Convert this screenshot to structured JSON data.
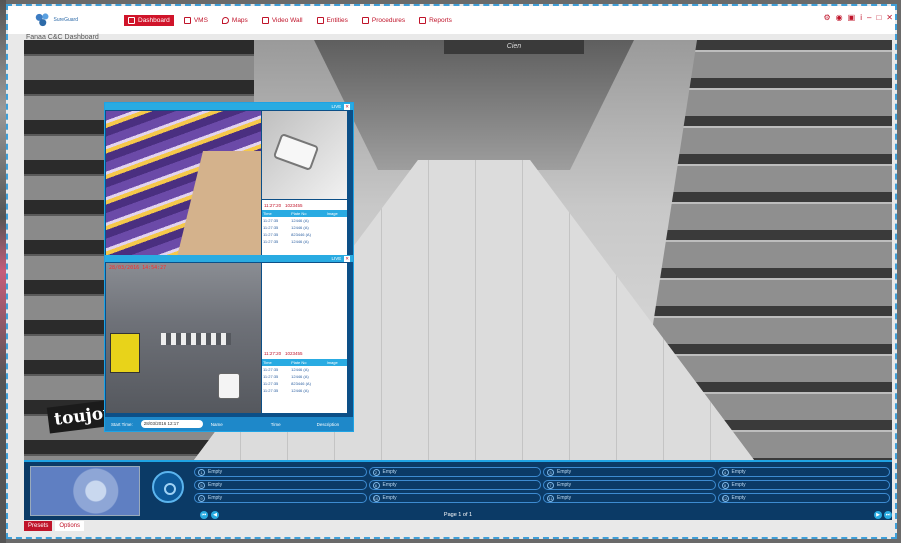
{
  "app": {
    "logo_text": "SureGuard",
    "subtitle": "Fanaa C&C Dashboard"
  },
  "nav": [
    {
      "label": "Dashboard",
      "icon": "dashboard-icon",
      "active": true
    },
    {
      "label": "VMS",
      "icon": "camera-icon",
      "active": false
    },
    {
      "label": "Maps",
      "icon": "map-pin-icon",
      "active": false
    },
    {
      "label": "Video Wall",
      "icon": "grid-icon",
      "active": false
    },
    {
      "label": "Entities",
      "icon": "entities-icon",
      "active": false
    },
    {
      "label": "Procedures",
      "icon": "procedures-icon",
      "active": false
    },
    {
      "label": "Reports",
      "icon": "chart-icon",
      "active": false
    }
  ],
  "window_controls": [
    "⚙",
    "◉",
    "▣",
    "i",
    "–",
    "□",
    "✕"
  ],
  "scene": {
    "ceiling_sign": "Cien",
    "brand_sign": "toujours"
  },
  "panel": {
    "live_label": "LIVE",
    "close_label": "✕",
    "feed2_timestamp": "28/03/2016 14:54:27",
    "event_time_a": "11:27:20",
    "event_time_b": "11:27:20",
    "event_id": "1023455",
    "table_headers": [
      "Time",
      "Plate No",
      "Image"
    ],
    "rows_a": [
      [
        "11:27:35",
        "12446 (A)",
        ""
      ],
      [
        "11:27:35",
        "12446 (A)",
        ""
      ],
      [
        "11:27:35",
        "823446 (A)",
        ""
      ],
      [
        "11:27:35",
        "12446 (A)",
        ""
      ]
    ],
    "rows_b": [
      [
        "11:27:35",
        "12446 (A)",
        ""
      ],
      [
        "11:27:35",
        "12446 (A)",
        ""
      ],
      [
        "11:27:35",
        "823446 (A)",
        ""
      ],
      [
        "11:27:35",
        "12446 (A)",
        ""
      ]
    ],
    "footer": {
      "start_time_label": "Start Time:",
      "start_time_value": "28/03/2016 12:17",
      "col_name": "Name",
      "col_time": "Time",
      "col_desc": "Description"
    }
  },
  "dock": {
    "slots": [
      {
        "n": "1",
        "label": "Empty"
      },
      {
        "n": "2",
        "label": "Empty"
      },
      {
        "n": "3",
        "label": "Empty"
      },
      {
        "n": "4",
        "label": "Empty"
      },
      {
        "n": "5",
        "label": "Empty"
      },
      {
        "n": "6",
        "label": "Empty"
      },
      {
        "n": "7",
        "label": "Empty"
      },
      {
        "n": "8",
        "label": "Empty"
      },
      {
        "n": "9",
        "label": "Empty"
      },
      {
        "n": "10",
        "label": "Empty"
      },
      {
        "n": "11",
        "label": "Empty"
      },
      {
        "n": "12",
        "label": "Empty"
      }
    ],
    "page_label": "Page 1 of 1",
    "first_btn": "⏮",
    "prev_btn": "◀",
    "next_btn": "▶",
    "last_btn": "⏭"
  },
  "tabs": [
    {
      "label": "Presets",
      "active": true
    },
    {
      "label": "Options",
      "active": false
    }
  ],
  "colors": {
    "accent_red": "#d0142a",
    "accent_blue": "#29abe2",
    "dock_bg": "#0b3a66"
  }
}
